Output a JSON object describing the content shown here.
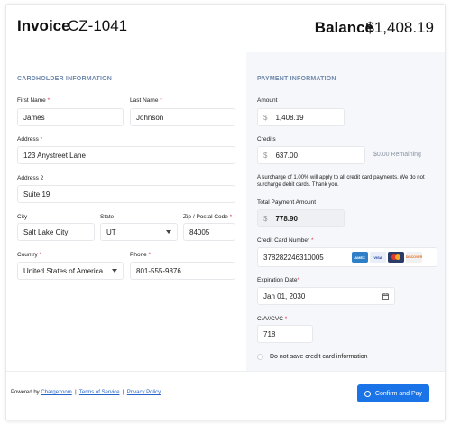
{
  "header": {
    "invoice_label": "Invoice",
    "invoice_number": "CZ-1041",
    "balance_label": "Balance",
    "balance_amount": "$1,408.19"
  },
  "cardholder": {
    "section_title": "CARDHOLDER INFORMATION",
    "first_name_label": "First Name",
    "first_name": "James",
    "last_name_label": "Last Name",
    "last_name": "Johnson",
    "address_label": "Address",
    "address": "123 Anystreet Lane",
    "address2_label": "Address 2",
    "address2": "Suite 19",
    "city_label": "City",
    "city": "Salt Lake City",
    "state_label": "State",
    "state": "UT",
    "zip_label": "Zip / Postal Code",
    "zip": "84005",
    "country_label": "Country",
    "country": "United States of America",
    "phone_label": "Phone",
    "phone": "801-555-9876",
    "required_mark": "*"
  },
  "payment": {
    "section_title": "PAYMENT INFORMATION",
    "amount_label": "Amount",
    "amount": "1,408.19",
    "currency_symbol": "$",
    "credits_label": "Credits",
    "credits": "637.00",
    "credits_remaining": "$0.00 Remaining",
    "surcharge_note": "A surcharge of 1.00% will apply to all credit card payments.  We do not surcharge debit cards.  Thank you.",
    "total_label": "Total Payment Amount",
    "total": "778.90",
    "card_number_label": "Credit Card Number",
    "card_number": "378282246310005",
    "card_brands": [
      "AMEX",
      "VISA",
      "MC",
      "DISCOVER"
    ],
    "expiration_label": "Expiration Date",
    "expiration": "Jan 01, 2030",
    "cvv_label": "CVV/CVC",
    "cvv": "718",
    "save_checkbox_label": "Do not save credit card information"
  },
  "footer": {
    "powered_by": "Powered by",
    "chargezoom_link": "Chargezoom",
    "separator": "|",
    "terms_link": "Terms of Service",
    "privacy_link": "Privacy Policy",
    "confirm_button": "Confirm and Pay"
  },
  "colors": {
    "accent": "#1b73e8",
    "section_title": "#6f89ac",
    "required": "#e0344f",
    "panel_bg": "#f6f7fa"
  }
}
